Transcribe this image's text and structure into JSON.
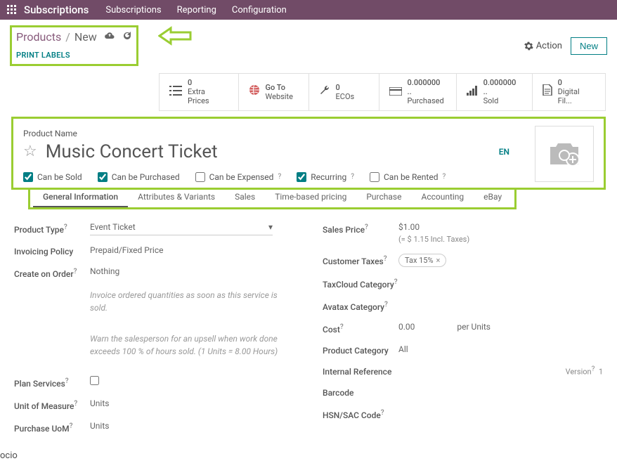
{
  "topbar": {
    "brand": "Subscriptions",
    "menu": [
      "Subscriptions",
      "Reporting",
      "Configuration"
    ]
  },
  "breadcrumbs": {
    "root": "Products",
    "current": "New",
    "print_labels": "PRINT LABELS"
  },
  "actions": {
    "action": "Action",
    "new": "New"
  },
  "stats": {
    "extra": {
      "val": "0",
      "lbl": "Extra Prices"
    },
    "goto": {
      "val": "Go To",
      "lbl": "Website"
    },
    "ecos": {
      "val": "0",
      "lbl": "ECOs"
    },
    "purchased": {
      "val": "0.000000 ..",
      "lbl": "Purchased"
    },
    "sold": {
      "val": "0.000000 ..",
      "lbl": "Sold"
    },
    "digital": {
      "val": "0",
      "lbl": "Digital Fil..."
    }
  },
  "product": {
    "name_label": "Product Name",
    "name": "Music Concert Ticket",
    "lang": "EN",
    "checks": {
      "sold": "Can be Sold",
      "purchased": "Can be Purchased",
      "expensed": "Can be Expensed",
      "recurring": "Recurring",
      "rented": "Can be Rented"
    }
  },
  "tabs": [
    "General Information",
    "Attributes & Variants",
    "Sales",
    "Time-based pricing",
    "Purchase",
    "Accounting",
    "eBay"
  ],
  "form": {
    "left": {
      "ptype_l": "Product Type",
      "ptype_v": "Event Ticket",
      "inv_l": "Invoicing Policy",
      "inv_v": "Prepaid/Fixed Price",
      "create_l": "Create on Order",
      "create_v": "Nothing",
      "help1": "Invoice ordered quantities as soon as this service is sold.",
      "help2": "Warn the salesperson for an upsell when work done exceeds 100     % of hours sold. (1 Units = 8.00 Hours)",
      "plan_l": "Plan Services",
      "uom_l": "Unit of Measure",
      "uom_v": "Units",
      "puom_l": "Purchase UoM",
      "puom_v": "Units"
    },
    "right": {
      "price_l": "Sales Price",
      "price_v": "$1.00",
      "price_tax": "(= $ 1.15 Incl. Taxes)",
      "ctax_l": "Customer Taxes",
      "ctax_v": "Tax 15%",
      "tcloud_l": "TaxCloud Category",
      "avatax_l": "Avatax Category",
      "cost_l": "Cost",
      "cost_v": "0.00",
      "cost_per": "per Units",
      "pcat_l": "Product Category",
      "pcat_v": "All",
      "iref_l": "Internal Reference",
      "ver_l": "Version",
      "ver_v": "1",
      "barcode_l": "Barcode",
      "hsn_l": "HSN/SAC Code"
    }
  }
}
